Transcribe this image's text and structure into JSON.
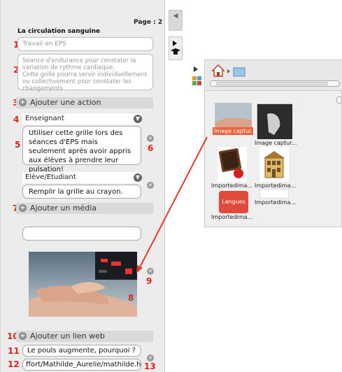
{
  "page_label": "Page : 2",
  "title": "La circulation sanguine",
  "activity_placeholder": "Travail en EPS",
  "description_placeholder": "Séance d'endurance pour constater la variation de rythme cardiaque.\nCette grille pourra servir individuellement ou collectivement pour constater les changements",
  "sections": {
    "add_action": "Ajouter une action",
    "add_media": "Ajouter un média",
    "add_link": "Ajouter un lien web"
  },
  "actions": [
    {
      "role": "Enseignant",
      "text": "Utiliser cette grille lors des séances d'EPS mais seulement après avoir appris aux élèves à prendre leur pulsation!"
    },
    {
      "role": "Elève/Etudiant",
      "text": "Remplir la grille au crayon."
    }
  ],
  "link": {
    "title": "Le pouls augmente, pourquoi ?",
    "url": "ffort/Mathilde_Aurelie/mathilde.htm"
  },
  "markers": [
    "1",
    "2",
    "3",
    "4",
    "5",
    "6",
    "7",
    "8",
    "9",
    "10",
    "11",
    "12",
    "13"
  ],
  "browser": {
    "items": [
      {
        "caption": "Image captur...",
        "selected": true
      },
      {
        "caption": "Image captur...",
        "selected": false
      },
      {
        "caption": "Importedima...",
        "selected": false
      },
      {
        "caption": "Importedima...",
        "selected": false
      },
      {
        "caption": "Langues",
        "selected": false
      },
      {
        "caption": "Importedima...",
        "selected": false
      },
      {
        "caption": "Importedima...",
        "selected": false
      }
    ]
  },
  "colors": {
    "marker": "#e0241b",
    "arrow": "#e33a2a",
    "selection": "#e8643c"
  }
}
